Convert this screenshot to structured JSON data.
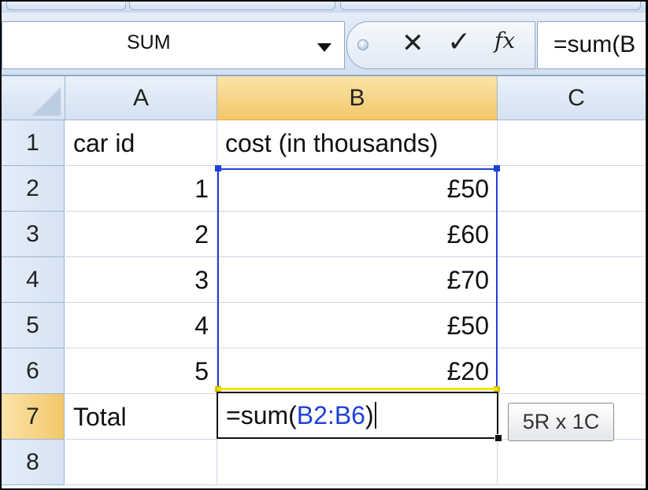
{
  "formula_bar": {
    "name_box": "SUM",
    "cancel_icon": "cancel-icon",
    "enter_icon": "checkmark-icon",
    "insert_function_label": "fx",
    "formula_text": "=sum(B"
  },
  "columns": [
    {
      "label": "A",
      "selected": false
    },
    {
      "label": "B",
      "selected": true
    },
    {
      "label": "C",
      "selected": false
    }
  ],
  "rows": [
    {
      "label": "1",
      "a": "car id",
      "b": "cost (in thousands)"
    },
    {
      "label": "2",
      "a": "1",
      "b": "£50"
    },
    {
      "label": "3",
      "a": "2",
      "b": "£60"
    },
    {
      "label": "4",
      "a": "3",
      "b": "£70"
    },
    {
      "label": "5",
      "a": "4",
      "b": "£50"
    },
    {
      "label": "6",
      "a": "5",
      "b": "£20"
    },
    {
      "label": "7",
      "a": "Total",
      "b": ""
    },
    {
      "label": "8",
      "a": "",
      "b": ""
    }
  ],
  "active_cell": {
    "prefix": "=sum(",
    "reference": "B2:B6",
    "suffix": ")"
  },
  "range_tooltip": "5R x 1C",
  "colors": {
    "range_border": "#1f3fd6",
    "selected_header": "#f3c76a",
    "header_bg": "#dde8f5"
  }
}
